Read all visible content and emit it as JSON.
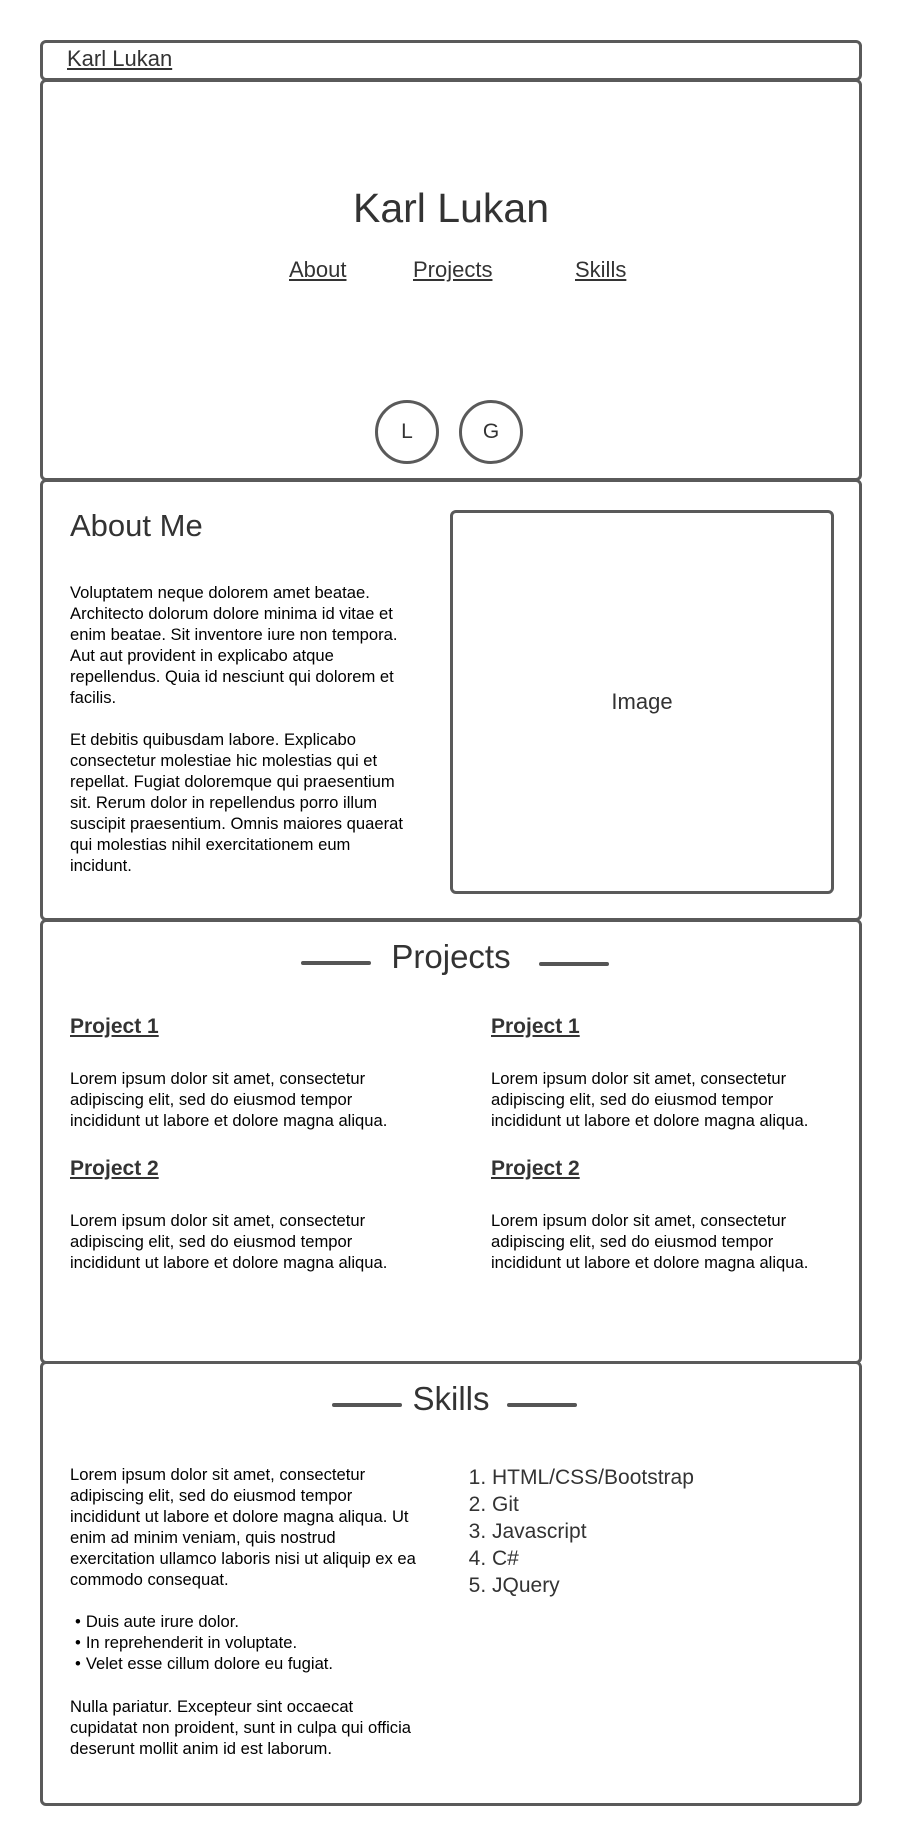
{
  "topbar": {
    "brand": "Karl Lukan"
  },
  "hero": {
    "title": "Karl Lukan",
    "nav": [
      "About",
      "Projects",
      "Skills"
    ],
    "social": [
      "L",
      "G"
    ]
  },
  "about": {
    "heading": "About Me",
    "paragraphs": [
      "Voluptatem neque dolorem amet beatae. Architecto dolorum dolore  minima id vitae et enim beatae. Sit inventore iure non tempora. Aut aut  provident in explicabo atque repellendus. Quia id nesciunt qui dolorem  et facilis.",
      "Et debitis quibusdam labore. Explicabo consectetur molestiae  hic molestias qui et repellat. Fugiat doloremque qui praesentium sit.  Rerum dolor in repellendus porro illum suscipit praesentium. Omnis  maiores quaerat qui molestias nihil exercitationem eum incidunt."
    ],
    "image_label": "Image"
  },
  "projects": {
    "heading": "Projects",
    "items": [
      {
        "title": "Project 1",
        "body": "Lorem ipsum dolor sit amet, consectetur adipiscing elit, sed do eiusmod tempor incididunt ut labore et dolore magna aliqua."
      },
      {
        "title": "Project 1",
        "body": "Lorem ipsum dolor sit amet, consectetur adipiscing elit, sed do eiusmod tempor incididunt ut labore et dolore magna aliqua."
      },
      {
        "title": "Project 2",
        "body": "Lorem ipsum dolor sit amet, consectetur adipiscing elit, sed do eiusmod tempor incididunt ut labore et dolore magna aliqua."
      },
      {
        "title": "Project 2",
        "body": "Lorem ipsum dolor sit amet, consectetur adipiscing elit, sed do eiusmod tempor incididunt ut labore et dolore magna aliqua."
      }
    ]
  },
  "skills": {
    "heading": "Skills",
    "intro": "Lorem ipsum dolor sit amet, consectetur adipiscing elit, sed do eiusmod  tempor incididunt ut labore et dolore magna aliqua. Ut enim ad minim  veniam, quis nostrud exercitation ullamco laboris nisi ut aliquip ex ea commodo consequat.",
    "bullets": [
      "Duis aute irure dolor.",
      "In reprehenderit in voluptate.",
      "Velet esse cillum dolore eu fugiat."
    ],
    "outro": "Nulla pariatur. Excepteur sint  occaecat cupidatat non proident, sunt in culpa qui officia deserunt mollit anim id est laborum.",
    "list": [
      "HTML/CSS/Bootstrap",
      "Git",
      "Javascript",
      "C#",
      "JQuery"
    ]
  }
}
